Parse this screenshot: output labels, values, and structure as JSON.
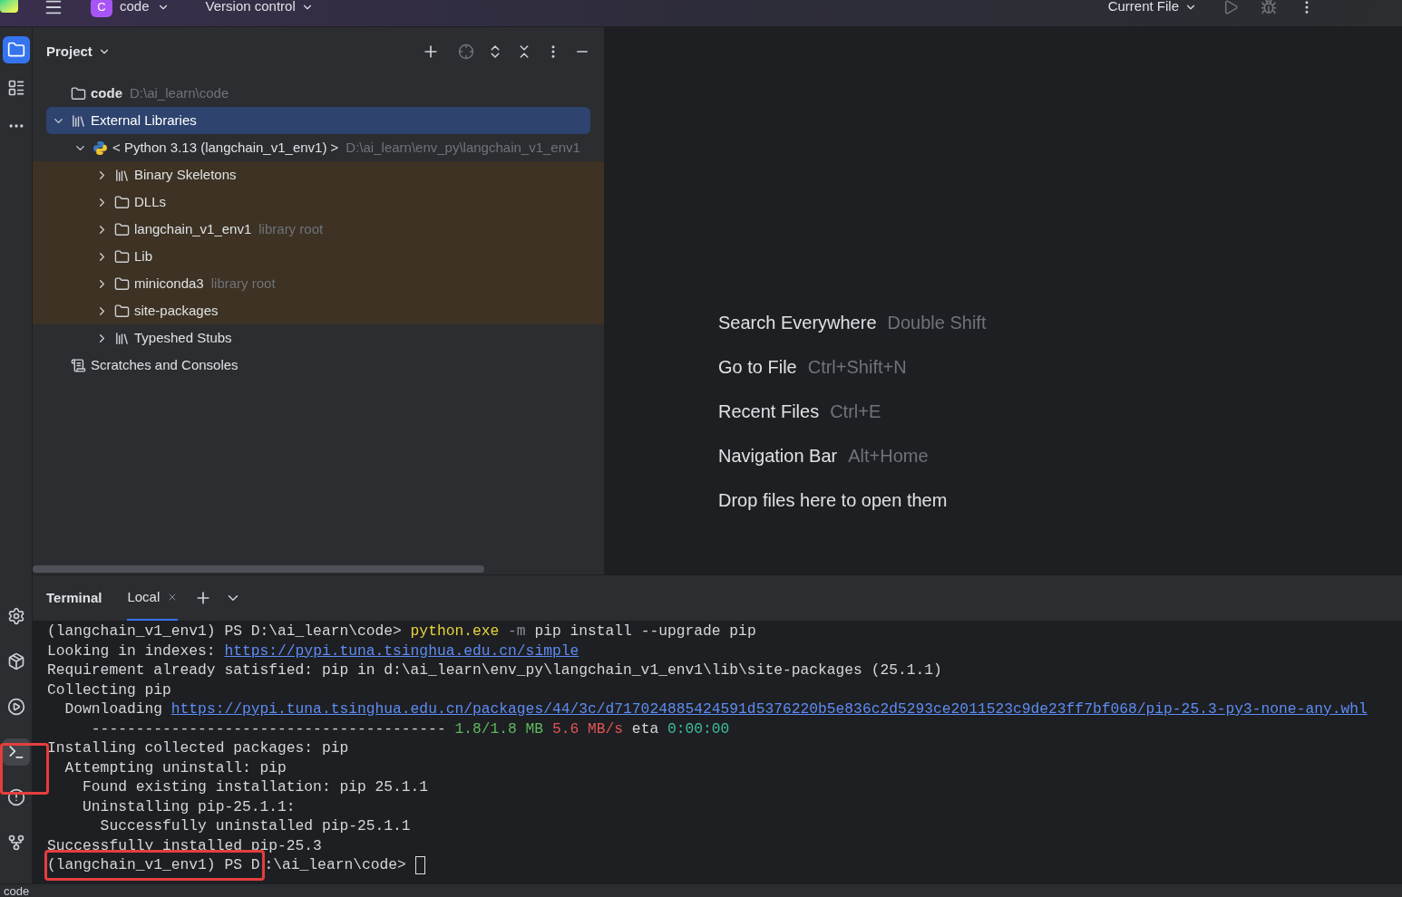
{
  "top_bar": {
    "project_badge": "C",
    "project": "code",
    "vcs": "Version control",
    "run_config": "Current File"
  },
  "tool_stripe": {
    "top": [
      {
        "kind": "folder",
        "selected": true
      },
      {
        "kind": "structure",
        "selected": false
      },
      {
        "kind": "more",
        "selected": false
      }
    ],
    "bottom": [
      {
        "kind": "python",
        "selected": false
      },
      {
        "kind": "packages",
        "selected": false
      },
      {
        "kind": "services",
        "selected": false
      },
      {
        "kind": "terminal",
        "selected": true
      },
      {
        "kind": "problems",
        "selected": false
      },
      {
        "kind": "git",
        "selected": false
      }
    ]
  },
  "project_panel": {
    "title": "Project",
    "tree": [
      {
        "label": "code",
        "hint": "D:\\ai_learn\\code",
        "kind": "folder",
        "bold": true,
        "selected": false,
        "highlighted": false
      },
      {
        "label": "External Libraries",
        "kind": "library",
        "expanded": true,
        "selected": true,
        "highlighted": false,
        "children": [
          {
            "label": "< Python 3.13 (langchain_v1_env1) >",
            "hint": "D:\\ai_learn\\env_py\\langchain_v1_env1",
            "kind": "python",
            "expanded": true,
            "selected": false,
            "highlighted": false,
            "children": [
              {
                "label": "Binary Skeletons",
                "kind": "library",
                "expanded": false,
                "selected": false,
                "highlighted": true
              },
              {
                "label": "DLLs",
                "kind": "folder",
                "expanded": false,
                "selected": false,
                "highlighted": true
              },
              {
                "label": "langchain_v1_env1",
                "hint": "library root",
                "kind": "folder",
                "expanded": false,
                "selected": false,
                "highlighted": true
              },
              {
                "label": "Lib",
                "kind": "folder",
                "expanded": false,
                "selected": false,
                "highlighted": true
              },
              {
                "label": "miniconda3",
                "hint": "library root",
                "kind": "folder",
                "expanded": false,
                "selected": false,
                "highlighted": true
              },
              {
                "label": "site-packages",
                "kind": "folder",
                "expanded": false,
                "selected": false,
                "highlighted": true
              },
              {
                "label": "Typeshed Stubs",
                "kind": "library",
                "expanded": false,
                "selected": false,
                "highlighted": false
              }
            ]
          }
        ]
      },
      {
        "label": "Scratches and Consoles",
        "kind": "scratches",
        "selected": false,
        "highlighted": false
      }
    ]
  },
  "editor_hints": [
    {
      "action": "Search Everywhere",
      "shortcut": "Double Shift"
    },
    {
      "action": "Go to File",
      "shortcut": "Ctrl+Shift+N"
    },
    {
      "action": "Recent Files",
      "shortcut": "Ctrl+E"
    },
    {
      "action": "Navigation Bar",
      "shortcut": "Alt+Home"
    },
    {
      "action": "Drop files here to open them"
    }
  ],
  "terminal": {
    "title": "Terminal",
    "tabs": [
      {
        "label": "Local",
        "selected": true
      }
    ],
    "lines": [
      [
        {
          "text": "(langchain_v1_env1) PS D:\\ai_learn\\code> ",
          "kind": "plain"
        },
        {
          "text": "python.exe",
          "kind": "yellow"
        },
        {
          "text": " -m ",
          "kind": "dim"
        },
        {
          "text": "pip install --upgrade pip",
          "kind": "plain"
        }
      ],
      [
        {
          "text": "Looking in indexes: ",
          "kind": "plain"
        },
        {
          "text": "https://pypi.tuna.tsinghua.edu.cn/simple",
          "kind": "link"
        }
      ],
      [
        {
          "text": "Requirement already satisfied: pip in d:\\ai_learn\\env_py\\langchain_v1_env1\\lib\\site-packages (25.1.1)",
          "kind": "plain"
        }
      ],
      [
        {
          "text": "Collecting pip",
          "kind": "plain"
        }
      ],
      [
        {
          "text": "  Downloading ",
          "kind": "plain"
        },
        {
          "text": "https://pypi.tuna.tsinghua.edu.cn/packages/44/3c/d717024885424591d5376220b5e836c2d5293ce2011523c9de23ff7bf068/pip-25.3-py3-none-any.whl",
          "kind": "link"
        }
      ],
      [
        {
          "text": "     ---------------------------------------- ",
          "kind": "plain"
        },
        {
          "text": "1.8/1.8 MB",
          "kind": "green"
        },
        {
          "text": " 5.6 MB/s",
          "kind": "red"
        },
        {
          "text": " eta ",
          "kind": "plain"
        },
        {
          "text": "0:00:00",
          "kind": "teal"
        }
      ],
      [
        {
          "text": "Installing collected packages: pip",
          "kind": "plain"
        }
      ],
      [
        {
          "text": "  Attempting uninstall: pip",
          "kind": "plain"
        }
      ],
      [
        {
          "text": "    Found existing installation: pip 25.1.1",
          "kind": "plain"
        }
      ],
      [
        {
          "text": "    Uninstalling pip-25.1.1:",
          "kind": "plain"
        }
      ],
      [
        {
          "text": "      Successfully uninstalled pip-25.1.1",
          "kind": "plain"
        }
      ],
      [
        {
          "text": "Successfully installed pip-25.3",
          "kind": "plain"
        }
      ],
      [
        {
          "text": "(langchain_v1_env1) PS D",
          "kind": "plain",
          "boxed": true
        },
        {
          "text": ":\\ai_learn\\code> ",
          "kind": "plain"
        }
      ]
    ]
  },
  "status_bar": {
    "path": "code"
  }
}
